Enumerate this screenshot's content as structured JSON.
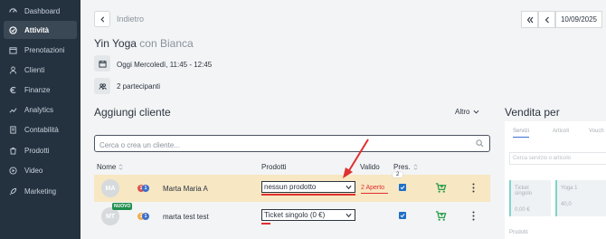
{
  "sidebar": {
    "items": [
      {
        "label": "Dashboard",
        "icon": "dashboard-icon",
        "active": false
      },
      {
        "label": "Attività",
        "icon": "activities-icon",
        "active": true
      },
      {
        "label": "Prenotazioni",
        "icon": "bookings-icon",
        "active": false
      },
      {
        "label": "Clienti",
        "icon": "user-icon",
        "active": false
      },
      {
        "label": "Finanze",
        "icon": "euro-icon",
        "active": false
      },
      {
        "label": "Analytics",
        "icon": "analytics-icon",
        "active": false
      },
      {
        "label": "Contabilità",
        "icon": "accounting-icon",
        "active": false
      },
      {
        "label": "Prodotti",
        "icon": "products-icon",
        "active": false
      },
      {
        "label": "Video",
        "icon": "play-icon",
        "active": false
      },
      {
        "label": "Marketing",
        "icon": "rocket-icon",
        "active": false
      }
    ]
  },
  "header": {
    "back_label": "Indietro",
    "date_value": "10/09/2025"
  },
  "activity": {
    "name": "Yin Yoga",
    "instructor": "con Bianca",
    "datetime": "Oggi Mercoledì, 11:45 - 12:45",
    "participants": "2 partecipanti"
  },
  "add_client": {
    "title": "Aggiungi cliente",
    "more_label": "Altro",
    "search_placeholder": "Cerca o crea un cliente..."
  },
  "table": {
    "headers": {
      "name": "Nome",
      "products": "Prodotti",
      "valid": "Valido",
      "pres": "Pres."
    },
    "tooltip": "2",
    "rows": [
      {
        "initials": "MA",
        "badge": "1",
        "badge_color": "#d9534f",
        "badge2": "1",
        "badge2_color": "#3b6fd0",
        "name": "Marta Maria A",
        "product": "nessun prodotto",
        "valid": "2 Aperto",
        "present": true,
        "new": false
      },
      {
        "initials": "MT",
        "badge": "1",
        "badge_color": "#f0ad4e",
        "badge2": "1",
        "badge2_color": "#3b6fd0",
        "name": "marta test test",
        "product": "Ticket singolo (0 €)",
        "valid": "",
        "present": true,
        "new": true,
        "new_label": "NUOVO"
      }
    ]
  },
  "sale_panel": {
    "title": "Vendita per",
    "tabs": [
      "Servizi",
      "Articoli",
      "Vouch"
    ],
    "search_placeholder": "Cerca servizio o articolo",
    "products": [
      {
        "name": "Ticket singolo",
        "price": "0,00 €"
      },
      {
        "name": "Yoga 1",
        "price": "40,0"
      }
    ],
    "section_label": "Prodotti"
  },
  "colors": {
    "sidebar_bg": "#243240",
    "highlight_row": "#f7e7c3",
    "alert_red": "#e03030",
    "cart_green": "#2a9d4a",
    "checkbox_blue": "#1f6fc7"
  }
}
